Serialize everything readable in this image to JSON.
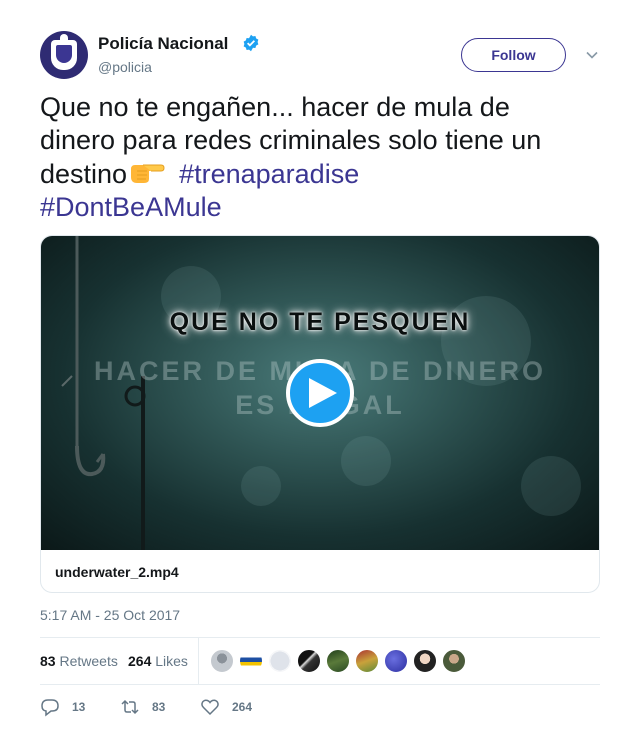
{
  "header": {
    "display_name": "Policía Nacional",
    "handle": "@policia",
    "follow_label": "Follow"
  },
  "tweet": {
    "text_part1": "Que no te engañen... hacer de mula de dinero para redes criminales solo tiene un destino",
    "hashtag1": "#trenaparadise",
    "hashtag2": "#DontBeAMule"
  },
  "media": {
    "video_title": "QUE NO TE PESQUEN",
    "video_subtitle_line1": "HACER DE MULA DE DINERO",
    "video_subtitle_line2": "ES ILEGAL",
    "filename": "underwater_2.mp4"
  },
  "timestamp": "5:17 AM - 25 Oct 2017",
  "stats": {
    "retweets_count": "83",
    "retweets_label": "Retweets",
    "likes_count": "264",
    "likes_label": "Likes"
  },
  "actions": {
    "reply_count": "13",
    "retweet_count": "83",
    "like_count": "264"
  },
  "colors": {
    "accent": "#3b3692",
    "play_button": "#1da1f2",
    "muted_text": "#657786"
  },
  "icons": [
    "verified-icon",
    "chevron-down-icon",
    "play-icon",
    "pointing-hand-emoji",
    "reply-icon",
    "retweet-icon",
    "heart-icon"
  ]
}
